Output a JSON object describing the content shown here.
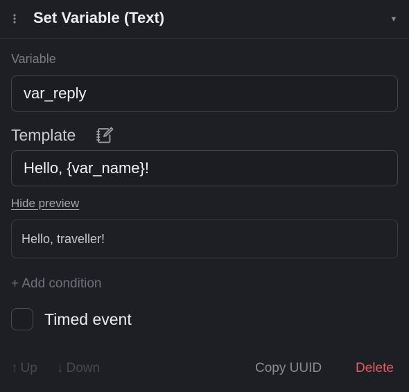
{
  "header": {
    "drag_icon": "drag-handle-icon",
    "title": "Set Variable (Text)",
    "collapse_icon": "chevron-down-icon",
    "collapse_glyph": "▼"
  },
  "variable": {
    "label": "Variable",
    "value": "var_reply"
  },
  "template": {
    "label": "Template",
    "edit_icon": "edit-note-icon",
    "value": "Hello, {var_name}!"
  },
  "preview": {
    "toggle_label": "Hide preview",
    "text": "Hello, traveller!"
  },
  "add_condition": "+ Add condition",
  "timed_event": {
    "label": "Timed event",
    "checked": false
  },
  "footer": {
    "up_arrow": "↑",
    "up_label": "Up",
    "down_arrow": "↓",
    "down_label": "Down",
    "copy_label": "Copy UUID",
    "delete_label": "Delete"
  },
  "colors": {
    "background": "#1e1f24",
    "danger": "#e35d62",
    "border": "#44464f"
  }
}
